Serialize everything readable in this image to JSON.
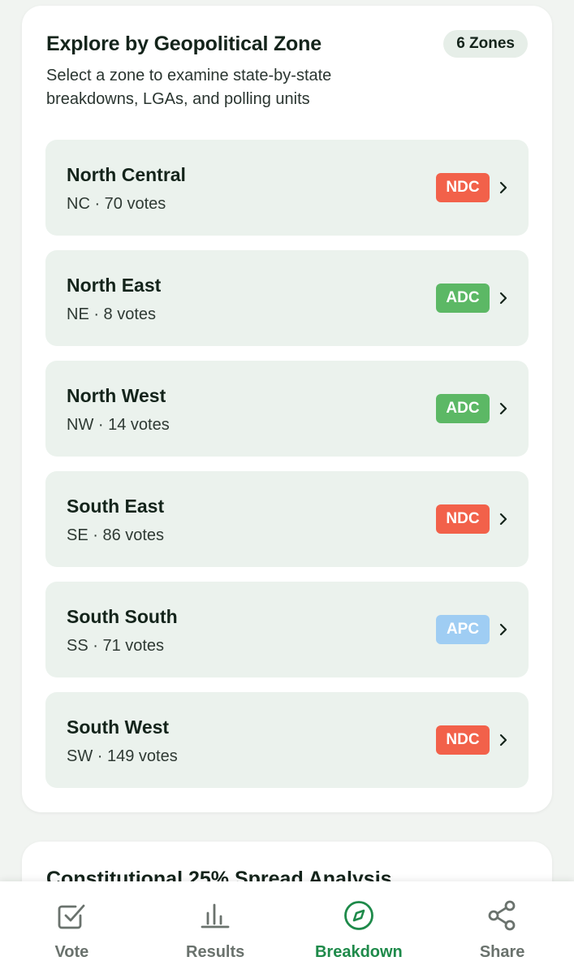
{
  "zone_section": {
    "title": "Explore by Geopolitical Zone",
    "badge": "6 Zones",
    "subtitle": "Select a zone to examine state-by-state breakdowns, LGAs, and polling units"
  },
  "zones": [
    {
      "name": "North Central",
      "meta": "NC · 70 votes",
      "party": "NDC",
      "party_color": "#f2614a"
    },
    {
      "name": "North East",
      "meta": "NE · 8 votes",
      "party": "ADC",
      "party_color": "#5cb865"
    },
    {
      "name": "North West",
      "meta": "NW · 14 votes",
      "party": "ADC",
      "party_color": "#5cb865"
    },
    {
      "name": "South East",
      "meta": "SE · 86 votes",
      "party": "NDC",
      "party_color": "#f2614a"
    },
    {
      "name": "South South",
      "meta": "SS · 71 votes",
      "party": "APC",
      "party_color": "#9fcdf3"
    },
    {
      "name": "South West",
      "meta": "SW · 149 votes",
      "party": "NDC",
      "party_color": "#f2614a"
    }
  ],
  "analysis_section": {
    "title": "Constitutional 25% Spread Analysis"
  },
  "nav": {
    "items": [
      {
        "label": "Vote",
        "icon": "checkbox-icon"
      },
      {
        "label": "Results",
        "icon": "bar-chart-icon"
      },
      {
        "label": "Breakdown",
        "icon": "compass-icon"
      },
      {
        "label": "Share",
        "icon": "share-icon"
      }
    ],
    "active": "Breakdown",
    "active_color": "#1e8a4a",
    "inactive_color": "#6a726d"
  }
}
